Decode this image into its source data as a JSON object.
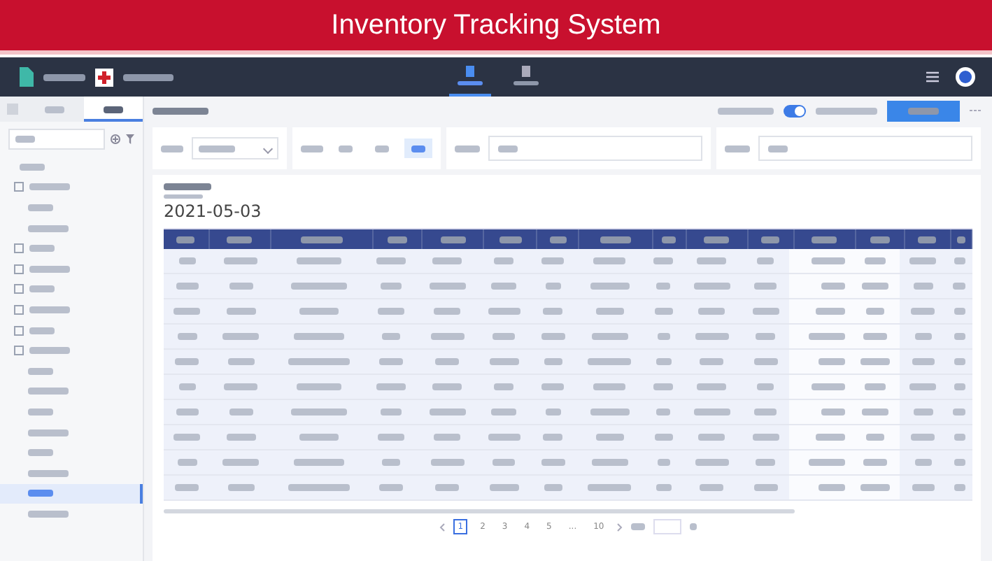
{
  "banner": {
    "title": "Inventory Tracking System"
  },
  "nav": {
    "tabs": [
      {
        "selected": true
      },
      {
        "selected": false
      }
    ]
  },
  "sidebar": {
    "tabs": [
      {
        "selected": false
      },
      {
        "selected": true
      }
    ],
    "items": [
      {
        "selected": false
      },
      {
        "selected": false
      },
      {
        "selected": false
      },
      {
        "selected": false
      },
      {
        "selected": false
      },
      {
        "selected": false
      },
      {
        "selected": false
      },
      {
        "selected": false
      },
      {
        "selected": false
      },
      {
        "selected": false
      },
      {
        "selected": false
      },
      {
        "selected": false
      },
      {
        "selected": false
      },
      {
        "selected": false
      },
      {
        "selected": false
      },
      {
        "selected": false
      },
      {
        "selected": true
      },
      {
        "selected": false
      }
    ]
  },
  "toolbar": {
    "toggle_on": true
  },
  "filters": {
    "segments": [
      {
        "selected": false
      },
      {
        "selected": false
      },
      {
        "selected": true
      }
    ]
  },
  "report": {
    "date": "2021-05-03"
  },
  "pagination": {
    "pages": [
      {
        "label": "1",
        "selected": true
      },
      {
        "label": "2",
        "selected": false
      },
      {
        "label": "3",
        "selected": false
      },
      {
        "label": "4",
        "selected": false
      },
      {
        "label": "5",
        "selected": false
      },
      {
        "label": "...",
        "selected": false
      },
      {
        "label": "10",
        "selected": false
      }
    ]
  }
}
